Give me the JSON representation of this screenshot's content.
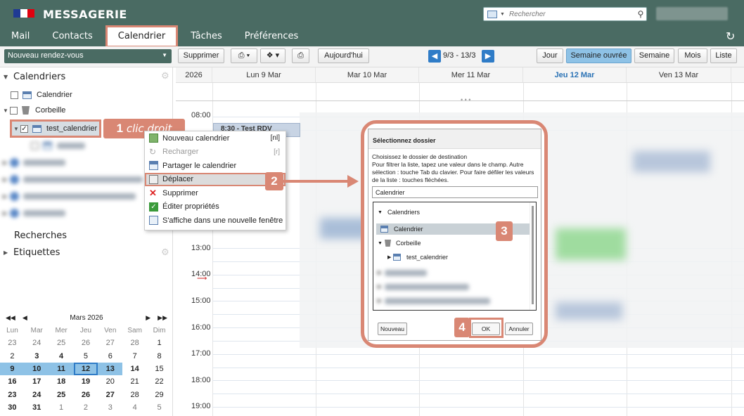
{
  "app": {
    "brand": "MESSAGERIE"
  },
  "search": {
    "placeholder": "Rechercher"
  },
  "nav": {
    "tabs": [
      "Mail",
      "Contacts",
      "Calendrier",
      "Tâches",
      "Préférences"
    ]
  },
  "toolbar": {
    "new_appointment": "Nouveau rendez-vous",
    "delete": "Supprimer",
    "today": "Aujourd'hui",
    "date_range": "9/3 - 13/3",
    "views": [
      "Jour",
      "Semaine ouvrée",
      "Semaine",
      "Mois",
      "Liste"
    ],
    "active_view": "Semaine ouvrée"
  },
  "sidebar": {
    "calendars_title": "Calendriers",
    "calendar_item": "Calendrier",
    "trash_item": "Corbeille",
    "selected_item": "test_calendrier",
    "searches": "Recherches",
    "tags": "Etiquettes"
  },
  "minical": {
    "month": "Mars 2026",
    "weekdays": [
      "Lun",
      "Mar",
      "Mer",
      "Jeu",
      "Ven",
      "Sam",
      "Dim"
    ],
    "rows": [
      [
        "23",
        "24",
        "25",
        "26",
        "27",
        "28",
        "1"
      ],
      [
        "2",
        "3",
        "4",
        "5",
        "6",
        "7",
        "8"
      ],
      [
        "9",
        "10",
        "11",
        "12",
        "13",
        "14",
        "15"
      ],
      [
        "16",
        "17",
        "18",
        "19",
        "20",
        "21",
        "22"
      ],
      [
        "23",
        "24",
        "25",
        "26",
        "27",
        "28",
        "29"
      ],
      [
        "30",
        "31",
        "1",
        "2",
        "3",
        "4",
        "5"
      ]
    ]
  },
  "calendar": {
    "year": "2026",
    "days": [
      "Lun 9 Mar",
      "Mar 10 Mar",
      "Mer 11 Mar",
      "Jeu 12 Mar",
      "Ven 13 Mar"
    ],
    "today": "Jeu 12 Mar",
    "hours": [
      "08:00",
      "13:00",
      "14:00",
      "15:00",
      "16:00",
      "17:00",
      "18:00",
      "19:00"
    ],
    "event": "8:30 - Test RDV"
  },
  "callouts": {
    "one": "1",
    "one_text": "clic droit",
    "two": "2",
    "three": "3",
    "four": "4"
  },
  "context_menu": {
    "items": [
      {
        "label": "Nouveau calendrier",
        "shortcut": "[nl]"
      },
      {
        "label": "Recharger",
        "shortcut": "[r]"
      },
      {
        "label": "Partager le calendrier",
        "shortcut": ""
      },
      {
        "label": "Déplacer",
        "shortcut": ""
      },
      {
        "label": "Supprimer",
        "shortcut": ""
      },
      {
        "label": "Éditer propriétés",
        "shortcut": ""
      },
      {
        "label": "S'affiche dans une nouvelle fenêtre",
        "shortcut": ""
      }
    ]
  },
  "dialog": {
    "title": "Sélectionnez dossier",
    "description": "Choisissez le dossier de destination\nPour filtrer la liste, tapez une valeur dans le champ. Autre sélection : touche Tab du clavier. Pour faire défiler les valeurs de la liste : touches fléchées.",
    "input_value": "Calendrier",
    "tree_root": "Calendriers",
    "tree_calendar": "Calendrier",
    "tree_trash": "Corbeille",
    "tree_test": "test_calendrier",
    "btn_new": "Nouveau",
    "btn_ok": "OK",
    "btn_cancel": "Annuler"
  },
  "colors": {
    "header": "#4a6b63",
    "accent": "#d98774",
    "blue": "#2f7cc7",
    "selected_view": "#8ec2e6"
  }
}
